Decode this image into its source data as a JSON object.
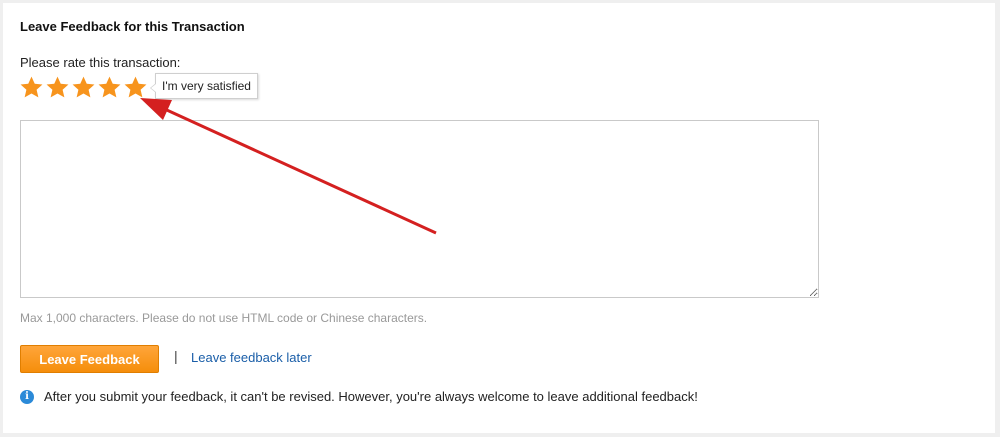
{
  "feedback": {
    "title": "Leave Feedback for this Transaction",
    "rate_label": "Please rate this transaction:",
    "rating": {
      "value": 5,
      "max": 5,
      "star_color": "#f7941d",
      "tooltip": "I'm very satisfied"
    },
    "comment_value": "",
    "hint": "Max 1,000 characters. Please do not use HTML code or Chinese characters.",
    "submit_label": "Leave Feedback",
    "separator": "|",
    "later_label": "Leave feedback later",
    "info_icon": "info-icon",
    "info_text": "After you submit your feedback, it can't be revised. However, you're always welcome to leave additional feedback!",
    "annotation_arrow_color": "#d42020"
  }
}
